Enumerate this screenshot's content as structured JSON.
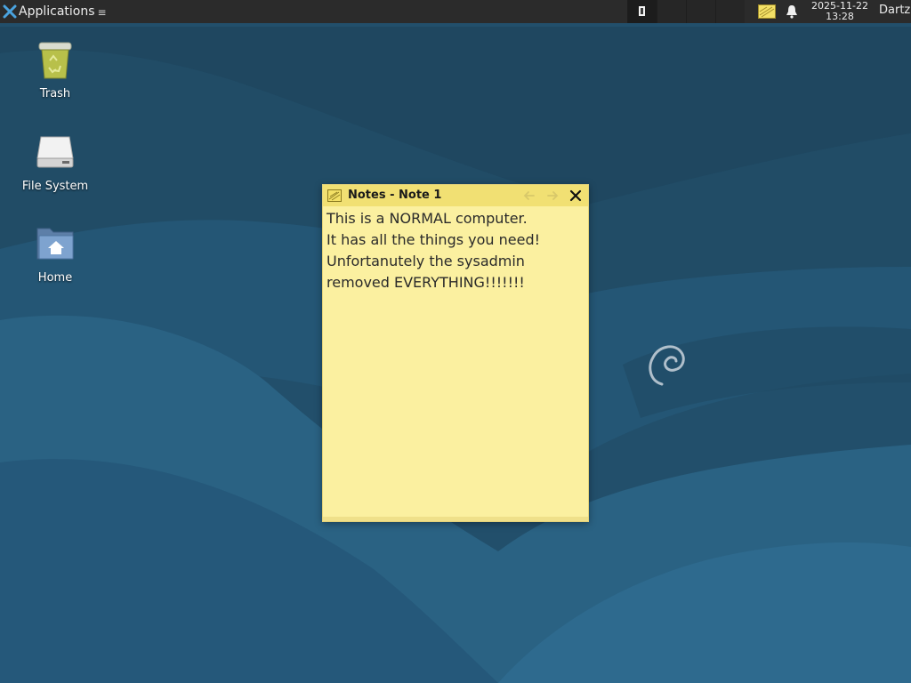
{
  "panel": {
    "applications_label": "Applications",
    "workspaces": [
      "1",
      "2",
      "3",
      "4"
    ],
    "clock": {
      "date": "2025-11-22",
      "time": "13:28"
    },
    "user": "Dartz",
    "icons": {
      "launcher": "xfce-logo-icon",
      "notes_tray": "notes-icon",
      "notifications": "bell-icon"
    }
  },
  "desktop": {
    "icons": [
      {
        "label": "Trash",
        "icon": "trash-icon"
      },
      {
        "label": "File System",
        "icon": "drive-icon"
      },
      {
        "label": "Home",
        "icon": "home-folder-icon"
      }
    ],
    "wallpaper_logo": "debian-swirl-icon"
  },
  "note": {
    "title": "Notes - Note 1",
    "lines": [
      "This is a NORMAL computer.",
      "It has all the things you need!",
      "Unfortanutely the sysadmin",
      "removed EVERYTHING!!!!!!!"
    ],
    "colors": {
      "body": "#fbf0a0",
      "titlebar": "#f1e073"
    }
  }
}
